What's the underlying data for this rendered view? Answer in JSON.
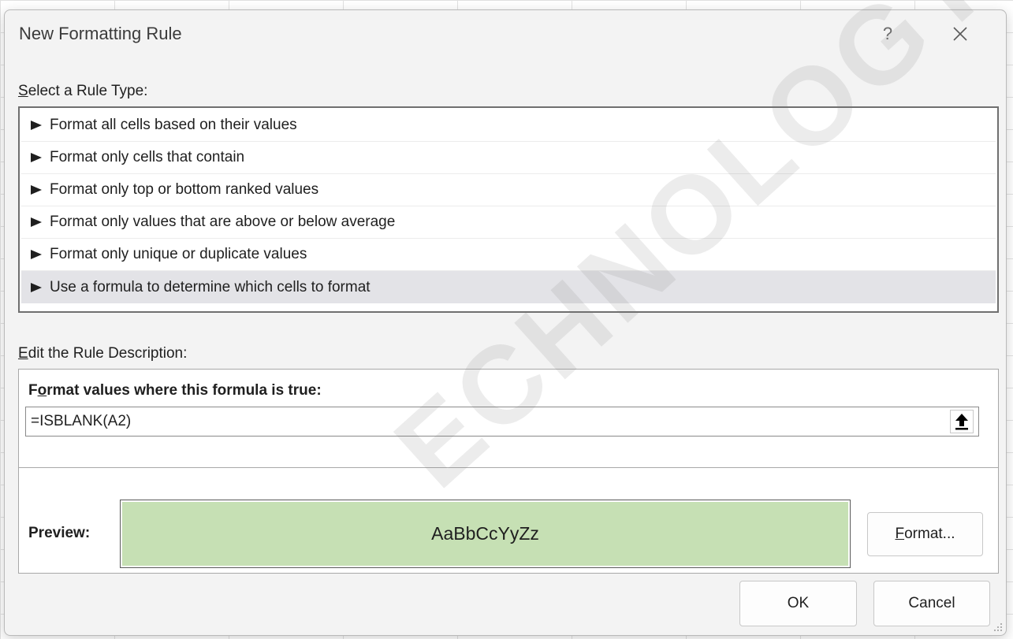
{
  "dialog": {
    "title": "New Formatting Rule",
    "help_label": "?",
    "close_icon": "close-icon"
  },
  "rule_type": {
    "label_accel": "S",
    "label_rest": "elect a Rule Type:",
    "items": [
      {
        "label": "Format all cells based on their values",
        "selected": false
      },
      {
        "label": "Format only cells that contain",
        "selected": false
      },
      {
        "label": "Format only top or bottom ranked values",
        "selected": false
      },
      {
        "label": "Format only values that are above or below average",
        "selected": false
      },
      {
        "label": "Format only unique or duplicate values",
        "selected": false
      },
      {
        "label": "Use a formula to determine which cells to format",
        "selected": true
      }
    ]
  },
  "rule_description": {
    "label_accel": "E",
    "label_rest": "dit the Rule Description:",
    "heading_pre": "F",
    "heading_accel": "o",
    "heading_rest": "rmat values where this formula is true:",
    "formula_value": "=ISBLANK(A2)",
    "preview_label": "Preview:",
    "preview_text": "AaBbCcYyZz",
    "preview_fill": "#c6e0b4",
    "format_button_accel": "F",
    "format_button_rest": "ormat..."
  },
  "buttons": {
    "ok": "OK",
    "cancel": "Cancel"
  },
  "watermark": "ECHNOLOGY.COM"
}
